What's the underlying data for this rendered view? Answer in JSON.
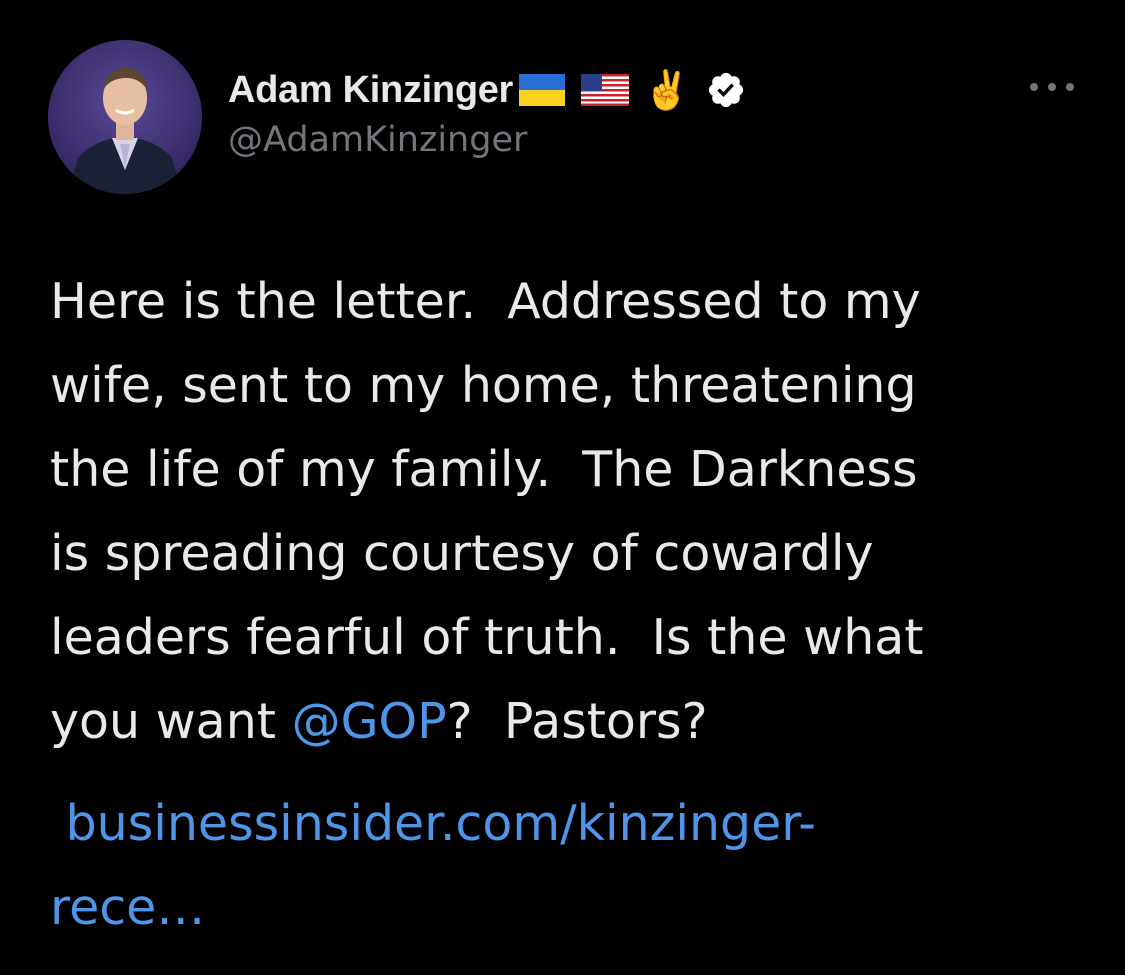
{
  "author": {
    "display_name": "Adam Kinzinger",
    "handle": "@AdamKinzinger",
    "emoji": "✌️"
  },
  "icons": {
    "flags": [
      "ukraine-flag-icon",
      "us-flag-icon"
    ],
    "victory": "victory-hand-icon",
    "verified": "verified-badge-icon",
    "more": "more-options-icon"
  },
  "colors": {
    "background": "#000000",
    "text": "#e7e9ea",
    "secondary": "#71767b",
    "link": "#4f95e8"
  },
  "tweet": {
    "lines": [
      "Here is the letter.  Addressed to my",
      "wife, sent to my home, threatening",
      "the life of my family.  The Darkness",
      "is spreading courtesy of cowardly",
      "leaders fearful of truth.  Is the what"
    ],
    "last_line_before_mention": "you want ",
    "mention": "@GOP",
    "last_line_after_mention": "?  Pastors?",
    "link_lines": [
      " businessinsider.com/kinzinger-",
      "rece…"
    ]
  }
}
